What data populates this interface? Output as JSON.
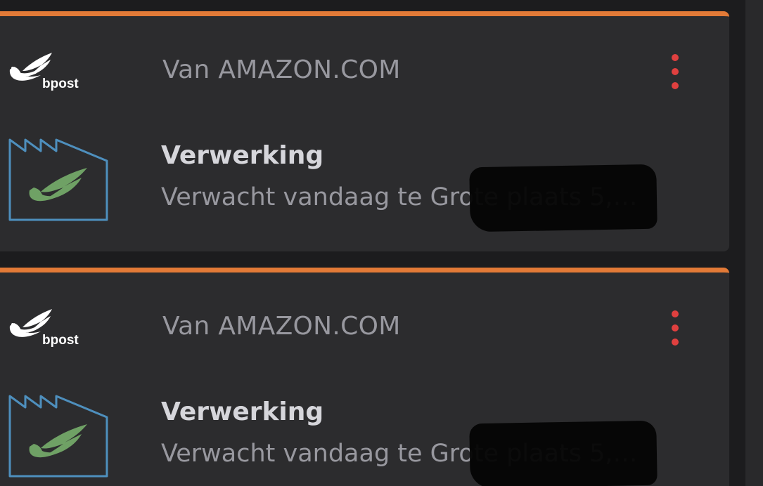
{
  "colors": {
    "background": "#1c1c1e",
    "card": "#2c2c2e",
    "accent_border": "#e27a37",
    "menu_dots": "#e0403f",
    "primary_text": "#d6d6db",
    "secondary_text": "#98989f",
    "factory_outline": "#4e8fbd",
    "factory_mark": "#6fa165"
  },
  "shipments": [
    {
      "carrier_logo": "bpost",
      "sender": "Van AMAZON.COM",
      "status": "Verwerking",
      "detail": "Verwacht vandaag te Grote plaats 5,…",
      "status_icon": "factory-icon",
      "menu_icon": "more-vertical-icon"
    },
    {
      "carrier_logo": "bpost",
      "sender": "Van AMAZON.COM",
      "status": "Verwerking",
      "detail": "Verwacht vandaag te Grote plaats 5,…",
      "status_icon": "factory-icon",
      "menu_icon": "more-vertical-icon"
    }
  ]
}
